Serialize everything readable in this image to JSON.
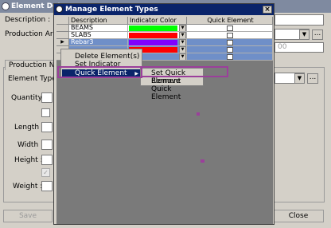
{
  "background_window": {
    "title": "Element Deta",
    "description_label": "Description :",
    "production_area_label": "Production Area :",
    "production_notes_tab": "Production Notes",
    "element_type_label": "Element Type :",
    "quantity_label": "Quantity :",
    "length_label": "Length :",
    "width_label": "Width :",
    "height_label": "Height :",
    "weight_label": "Weight :",
    "right_value": "00",
    "browse_button": "...",
    "save_button": "Save",
    "close_button": "Close"
  },
  "dialog": {
    "title": "Manage Element Types",
    "close_glyph": "×",
    "columns": [
      "Description",
      "Indicator Color",
      "Quick Element"
    ],
    "rows": [
      {
        "description": "BEAMS",
        "color": "#00ff00",
        "selected": false,
        "current": false
      },
      {
        "description": "SLABS",
        "color": "#ff0000",
        "selected": false,
        "current": false
      },
      {
        "description": "Rebar3",
        "color": "#8000ff",
        "selected": true,
        "current": true
      },
      {
        "description": "",
        "color": "#ff0000",
        "selected": true,
        "current": false
      },
      {
        "description": "",
        "color": "",
        "selected": true,
        "current": false
      }
    ]
  },
  "context_menu": {
    "items": [
      "Delete Element(s)",
      "Set Indicator Colour",
      "Quick Element"
    ],
    "highlight_color": "#9b3f9b"
  },
  "submenu": {
    "items": [
      "Set Quick Element",
      "Remove Quick Element"
    ]
  },
  "colors": {
    "selection_blue": "#0a246a",
    "row_selected": "#6f8fc8",
    "annotation_purple": "#9b3f9b"
  }
}
